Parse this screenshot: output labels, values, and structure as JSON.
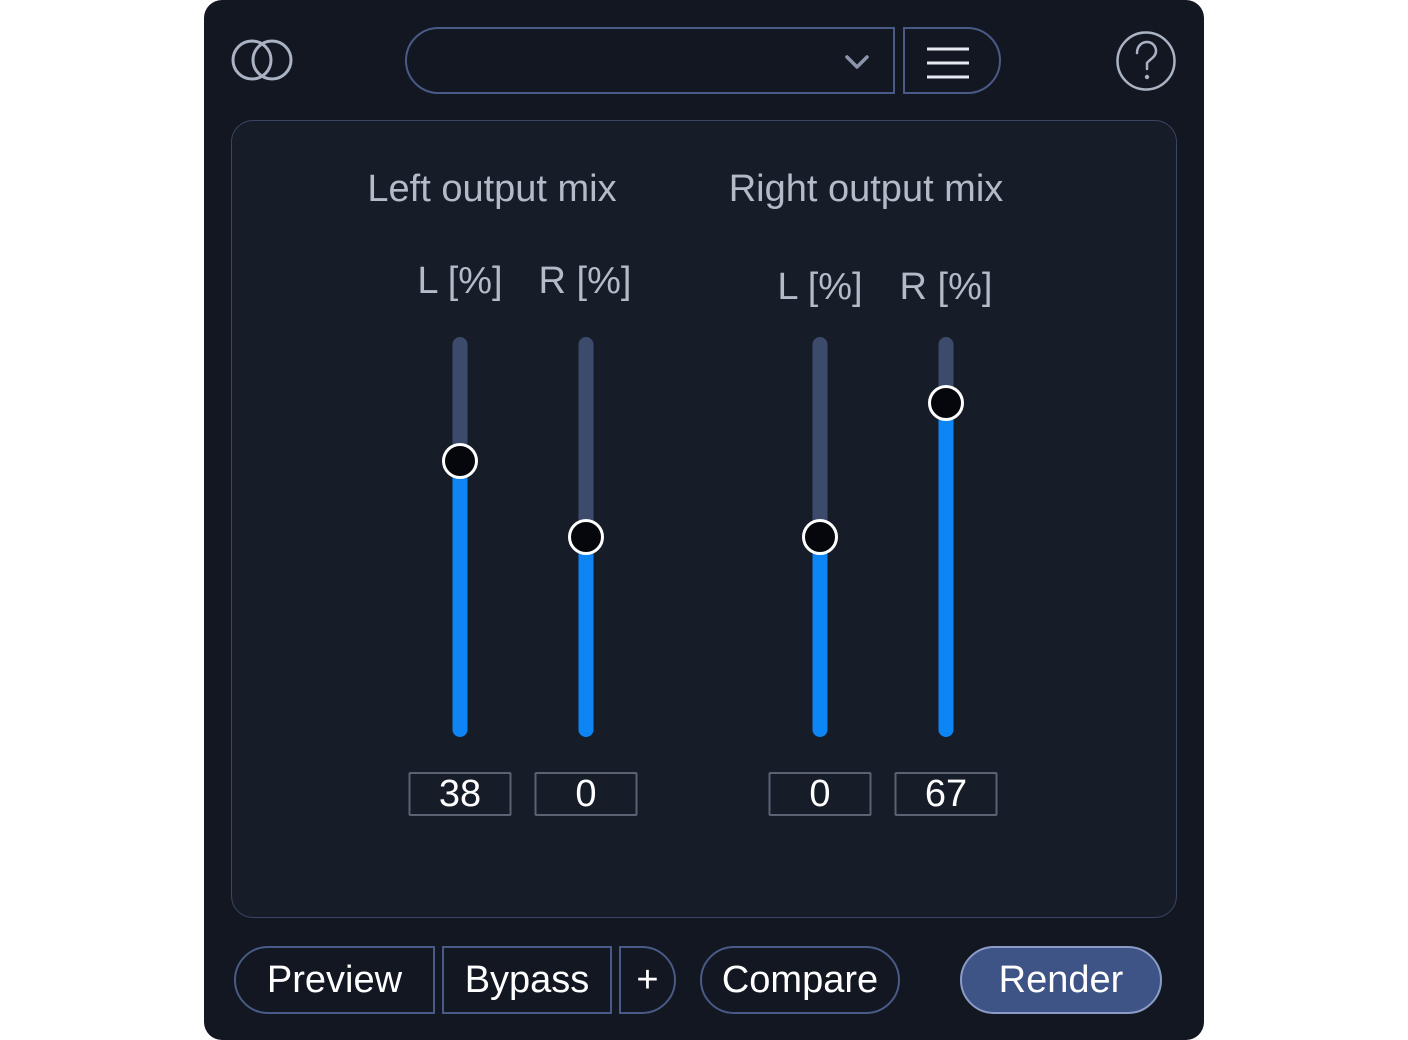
{
  "header": {
    "logo_icon": "overlapping-circles-icon",
    "preset_value": "",
    "dropdown_icon": "chevron-down-icon",
    "menu_icon": "hamburger-menu-icon",
    "help_icon": "question-mark-icon"
  },
  "groups": [
    {
      "title": "Left output mix",
      "channels": [
        {
          "label": "L [%]",
          "value": "38",
          "level": 0.69
        },
        {
          "label": "R [%]",
          "value": "0",
          "level": 0.5
        }
      ]
    },
    {
      "title": "Right output mix",
      "channels": [
        {
          "label": "L [%]",
          "value": "0",
          "level": 0.5
        },
        {
          "label": "R [%]",
          "value": "67",
          "level": 0.835
        }
      ]
    }
  ],
  "footer": {
    "preview": "Preview",
    "bypass": "Bypass",
    "plus": "+",
    "compare": "Compare",
    "render": "Render"
  },
  "colors": {
    "background": "#131722",
    "panel": "#161c28",
    "accent_fill": "#0d85f5",
    "track": "#3c4a6b",
    "border": "#4a5a86",
    "render_button": "#3e5486"
  }
}
